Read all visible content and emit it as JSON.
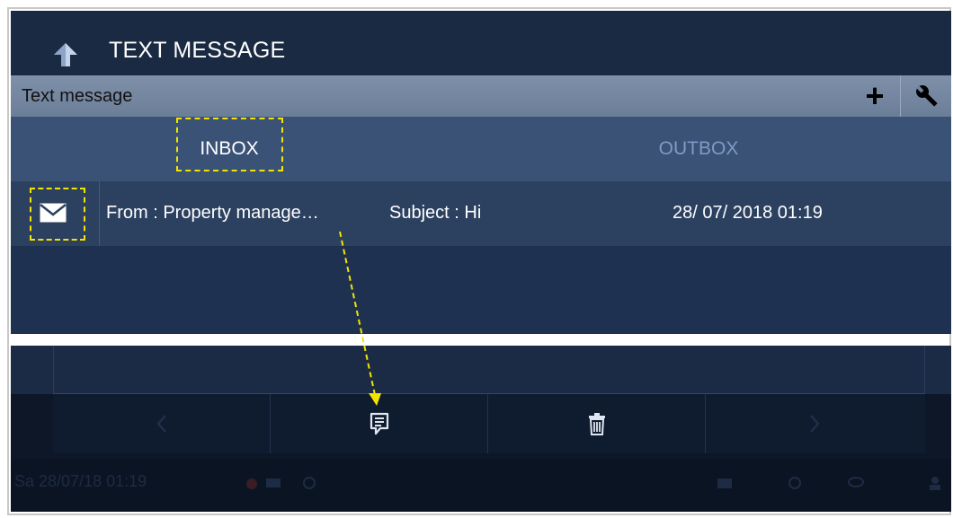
{
  "header": {
    "title": "TEXT MESSAGE",
    "back_icon": "back-arrow-icon"
  },
  "subheader": {
    "title": "Text message",
    "add_label": "+",
    "settings_icon": "wrench-icon"
  },
  "tabs": [
    {
      "label": "INBOX",
      "active": true
    },
    {
      "label": "OUTBOX",
      "active": false
    }
  ],
  "messages": [
    {
      "icon": "envelope-icon",
      "from": "From : Property manage…",
      "subject": "Subject : Hi",
      "datetime": "28/ 07/ 2018 01:19"
    }
  ],
  "toolbar": {
    "buttons": [
      "prev-icon",
      "view-message-icon",
      "trash-icon",
      "next-icon"
    ]
  },
  "status_bar": {
    "datetime": "Sa 28/07/18  01:19"
  },
  "colors": {
    "highlight": "#f2e400",
    "title_bar": "#1a2a42",
    "subheader": "#7384a0",
    "tab_bar": "#3b5277",
    "row": "#2c4160",
    "inactive_tab": "#7f9ac5"
  }
}
